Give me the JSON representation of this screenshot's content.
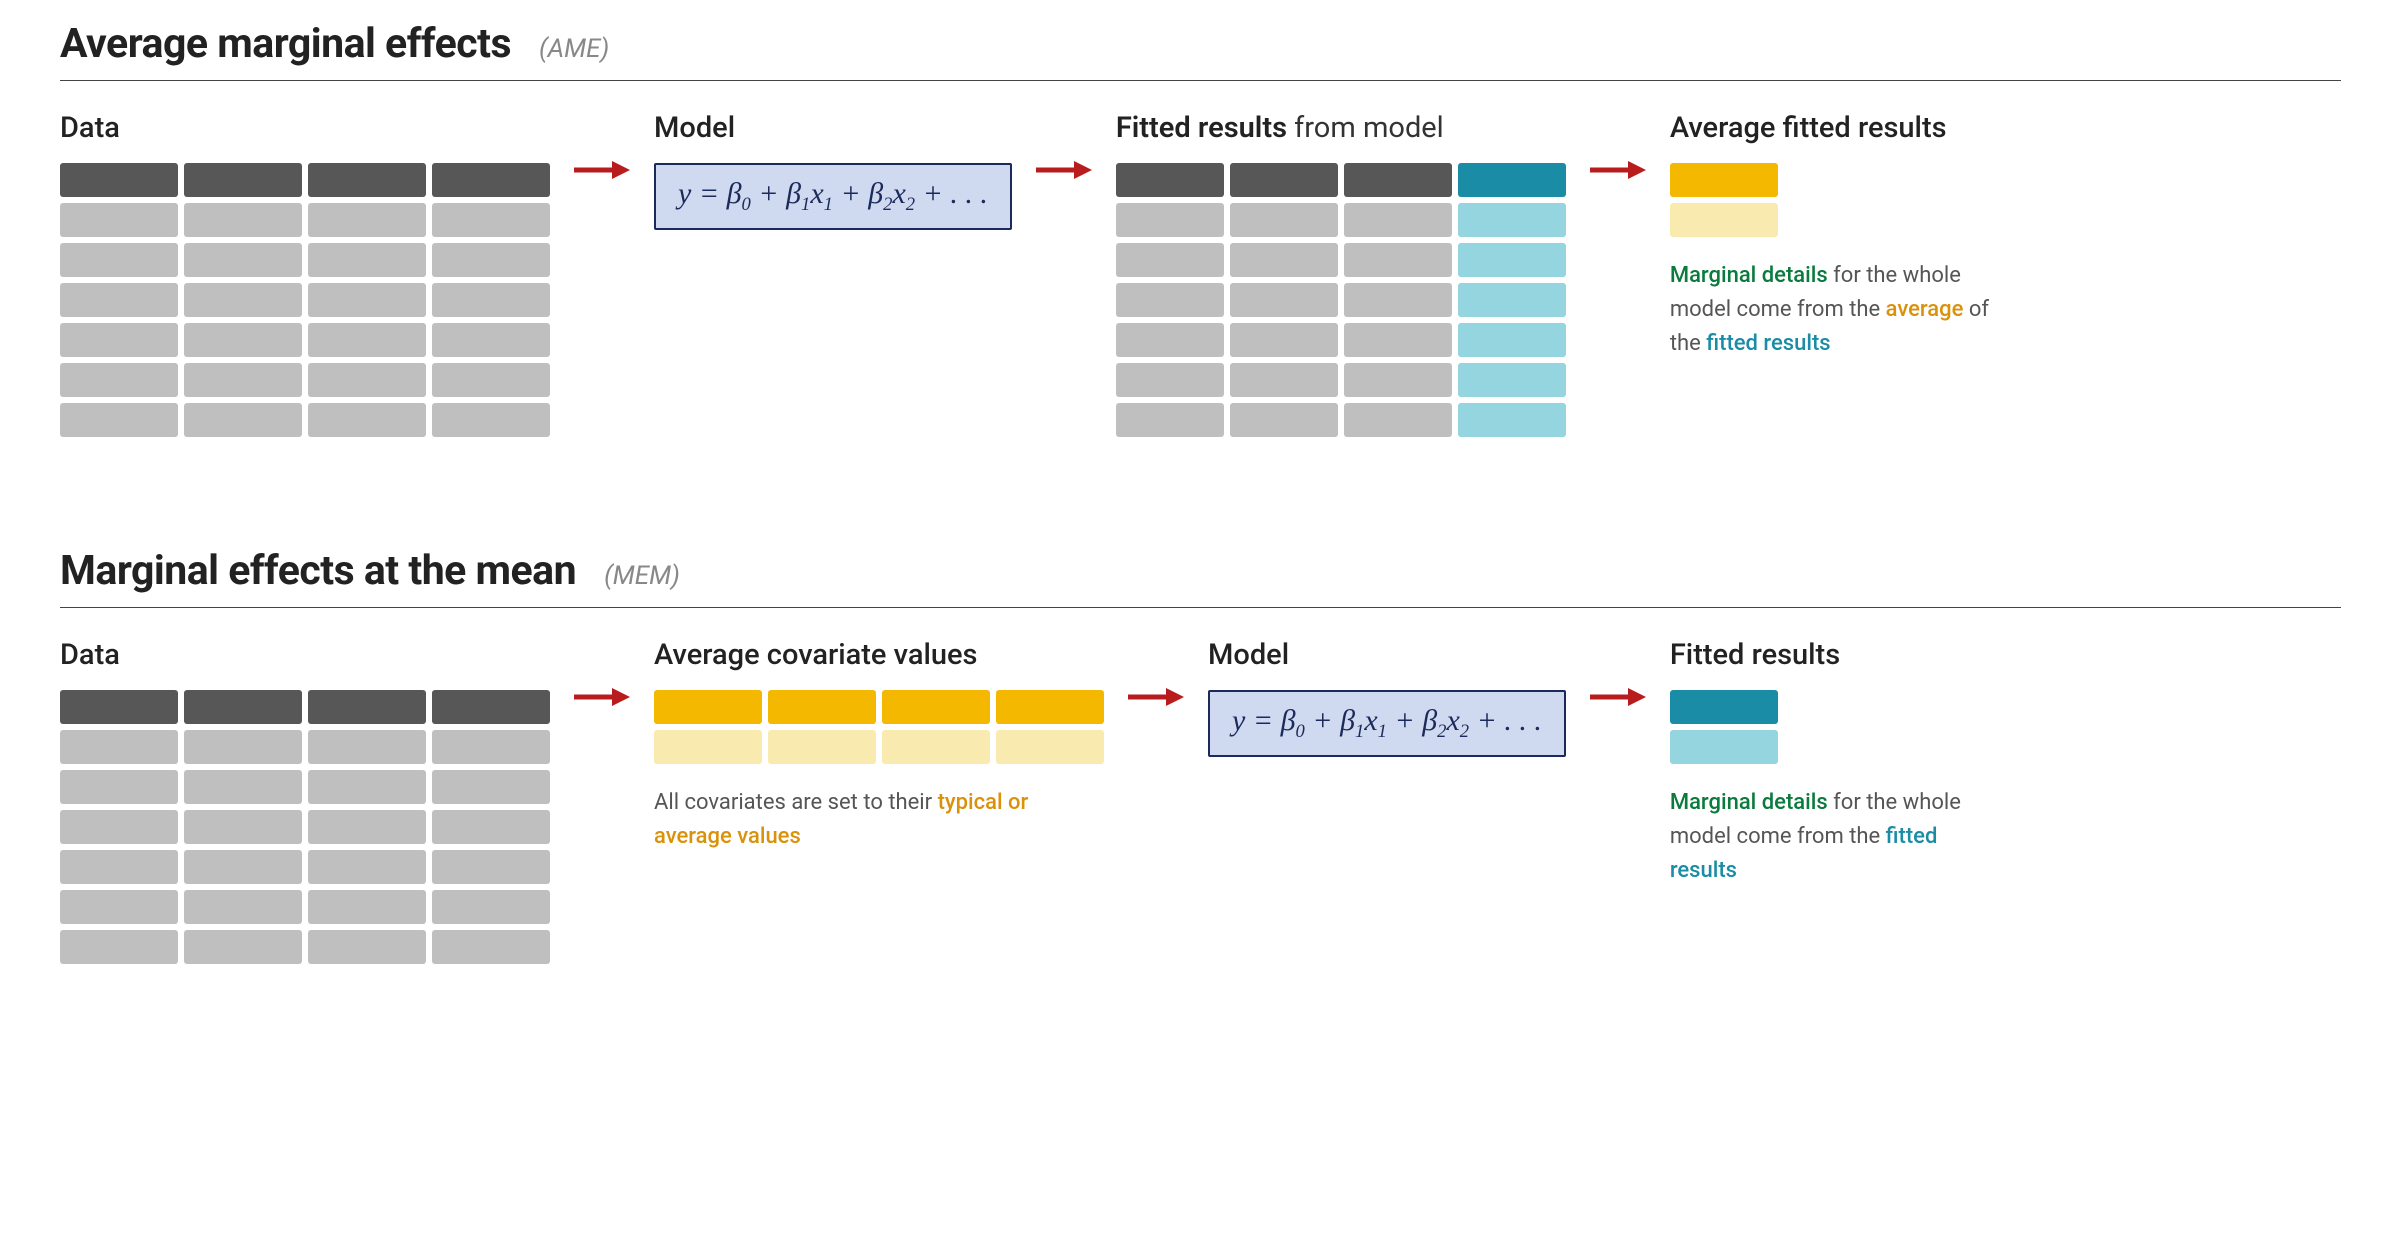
{
  "ame": {
    "title": "Average marginal effects",
    "abbr": "(AME)",
    "data_label": "Data",
    "model_label": "Model",
    "fitted_label_strong": "Fitted results",
    "fitted_label_rest": " from model",
    "avg_label": "Average fitted results",
    "caption_p1": "Marginal details",
    "caption_p2": " for the whole model come from the ",
    "caption_p3": "average",
    "caption_p4": " of the ",
    "caption_p5": "fitted results"
  },
  "mem": {
    "title": "Marginal effects at the mean",
    "abbr": "(MEM)",
    "data_label": "Data",
    "avgcov_label": "Average covariate values",
    "model_label": "Model",
    "fitted_label": "Fitted results",
    "cov_caption_p1": "All covariates are set to their ",
    "cov_caption_p2": "typical or average values",
    "caption_p1": "Marginal details",
    "caption_p2": " for the whole model come from the ",
    "caption_p3": "fitted results"
  },
  "formula": {
    "y": "y",
    "eq": " = ",
    "b0": "β",
    "s0": "0",
    "plus": " + ",
    "b1": "β",
    "s1": "1",
    "x1": "x",
    "sx1": "1",
    "b2": "β",
    "s2": "2",
    "x2": "x",
    "sx2": "2",
    "dots": " + . . ."
  },
  "colors": {
    "arrow": "#b81c1c"
  }
}
